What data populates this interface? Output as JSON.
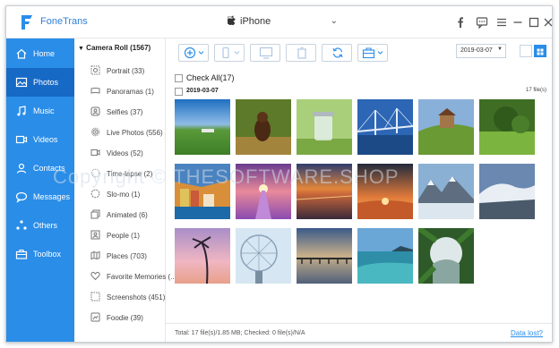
{
  "app": {
    "title": "FoneTrans",
    "device": "iPhone"
  },
  "sidebar": {
    "items": [
      {
        "label": "Home",
        "icon": "home-icon"
      },
      {
        "label": "Photos",
        "icon": "photos-icon"
      },
      {
        "label": "Music",
        "icon": "music-icon"
      },
      {
        "label": "Videos",
        "icon": "videos-icon"
      },
      {
        "label": "Contacts",
        "icon": "contacts-icon"
      },
      {
        "label": "Messages",
        "icon": "messages-icon"
      },
      {
        "label": "Others",
        "icon": "others-icon"
      },
      {
        "label": "Toolbox",
        "icon": "toolbox-icon"
      }
    ],
    "active": "Photos"
  },
  "albums": {
    "header": "Camera Roll (1567)",
    "items": [
      {
        "label": "Portrait (33)",
        "icon": "portrait-icon"
      },
      {
        "label": "Panoramas (1)",
        "icon": "panorama-icon"
      },
      {
        "label": "Selfies (37)",
        "icon": "selfie-icon"
      },
      {
        "label": "Live Photos (556)",
        "icon": "live-photo-icon"
      },
      {
        "label": "Videos (52)",
        "icon": "video-icon"
      },
      {
        "label": "Time-lapse (2)",
        "icon": "time-lapse-icon"
      },
      {
        "label": "Slo-mo (1)",
        "icon": "slo-mo-icon"
      },
      {
        "label": "Animated (6)",
        "icon": "animated-icon"
      },
      {
        "label": "People (1)",
        "icon": "people-icon"
      },
      {
        "label": "Places (703)",
        "icon": "places-icon"
      },
      {
        "label": "Favorite Memories (...",
        "icon": "heart-icon"
      },
      {
        "label": "Screenshots (451)",
        "icon": "screenshot-icon"
      },
      {
        "label": "Foodie (39)",
        "icon": "foodie-icon"
      }
    ]
  },
  "toolbar": {
    "date_filter": "2019-03-07"
  },
  "content": {
    "check_all": "Check All(17)",
    "group_date": "2019-03-07",
    "group_count": "17 file(s)",
    "photo_count": 17
  },
  "watermark": "Copyright © THESOFTWARE.SHOP",
  "status": {
    "text": "Total: 17 file(s)/1.85 MB; Checked: 0 file(s)/N/A",
    "link": "Data lost?"
  },
  "colors": {
    "accent": "#2a8de8",
    "sidebar_active": "#1769c6"
  }
}
